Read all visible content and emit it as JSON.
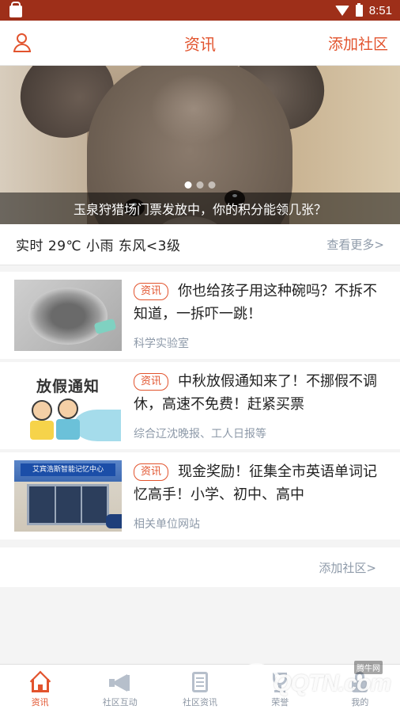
{
  "status_bar": {
    "time": "8:51"
  },
  "app_bar": {
    "title": "资讯",
    "right_action": "添加社区"
  },
  "banner": {
    "caption": "玉泉狩猎场门票发放中，你的积分能领几张？",
    "slide_count": 3,
    "active_slide": 1
  },
  "weather": {
    "text": "实时 29℃ 小雨 东风<3级",
    "more": "查看更多>"
  },
  "news": [
    {
      "tag": "资讯",
      "title": "你也给孩子用这种碗吗？不拆不知道，一拆吓一跳！",
      "source": "科学实验室"
    },
    {
      "tag": "资讯",
      "title": "中秋放假通知来了！不挪假不调休，高速不免费！赶紧买票",
      "source": "综合辽沈晚报、工人日报等"
    },
    {
      "tag": "资讯",
      "title": "现金奖励！征集全市英语单词记忆高手！小学、初中、高中",
      "source": "相关单位网站"
    }
  ],
  "thumb_text": {
    "holiday": "放假通知",
    "store_sign": "艾宾浩斯智能记忆中心"
  },
  "add_community_link": "添加社区>",
  "bottom_nav": [
    {
      "label": "资讯",
      "icon": "home-icon",
      "active": true
    },
    {
      "label": "社区互动",
      "icon": "megaphone-icon",
      "active": false
    },
    {
      "label": "社区资讯",
      "icon": "document-icon",
      "active": false
    },
    {
      "label": "荣誉",
      "icon": "trophy-icon",
      "active": false
    },
    {
      "label": "我的",
      "icon": "lock-icon",
      "active": false
    }
  ],
  "watermark": {
    "text": "QQTN.com",
    "badge": "腾牛网"
  },
  "colors": {
    "accent": "#e2532d",
    "status_bar": "#9e2f19",
    "muted": "#8e9aa9"
  }
}
